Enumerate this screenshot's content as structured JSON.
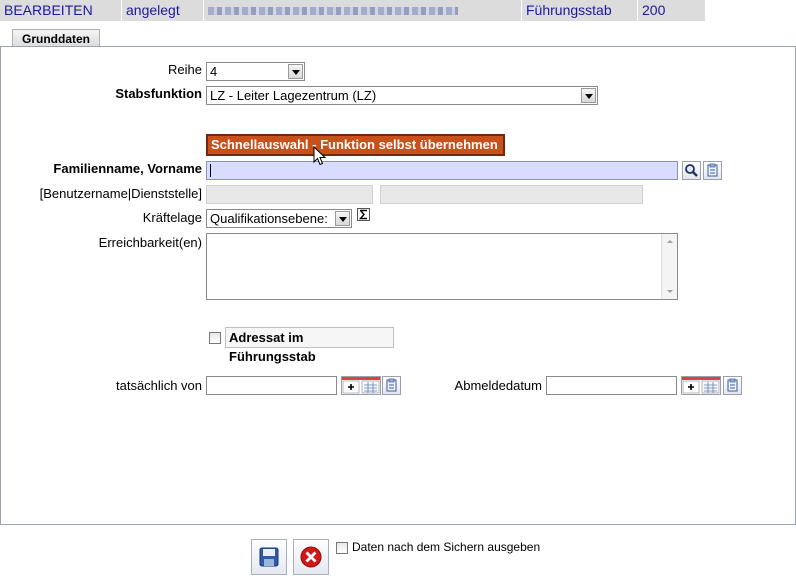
{
  "header": {
    "mode": "BEARBEITEN",
    "status": "angelegt",
    "staff": "Führungsstab",
    "number": "200"
  },
  "tabs": [
    {
      "label": "Grunddaten",
      "active": true
    }
  ],
  "form": {
    "reihe": {
      "label": "Reihe",
      "value": "4"
    },
    "stabsfunktion": {
      "label": "Stabsfunktion",
      "value": "LZ - Leiter Lagezentrum (LZ)"
    },
    "quick_select_button": "Schnellauswahl - Funktion selbst übernehmen",
    "name": {
      "label": "Familienname, Vorname",
      "value": ""
    },
    "user_office": {
      "label": "[Benutzername|Dienststelle]",
      "username": "",
      "office": ""
    },
    "kraeftelage": {
      "label": "Kräftelage",
      "value": "Qualifikationsebene:"
    },
    "erreichbarkeit": {
      "label": "Erreichbarkeit(en)",
      "value": ""
    },
    "adressat": {
      "label": "Adressat im Führungsstab",
      "checked": false
    },
    "tatsaechlich_von": {
      "label": "tatsächlich von",
      "value": ""
    },
    "abmeldedatum": {
      "label": "Abmeldedatum",
      "value": ""
    }
  },
  "footer": {
    "print_after_save": {
      "label": "Daten nach dem Sichern ausgeben",
      "checked": false
    },
    "save_icon": "floppy-disk-icon",
    "cancel_icon": "red-cancel-icon"
  },
  "colors": {
    "header_bg": "#dcdcdc",
    "header_text": "#1a1a9c",
    "accent_button": "#c8501a",
    "active_input": "#d8dcff"
  }
}
